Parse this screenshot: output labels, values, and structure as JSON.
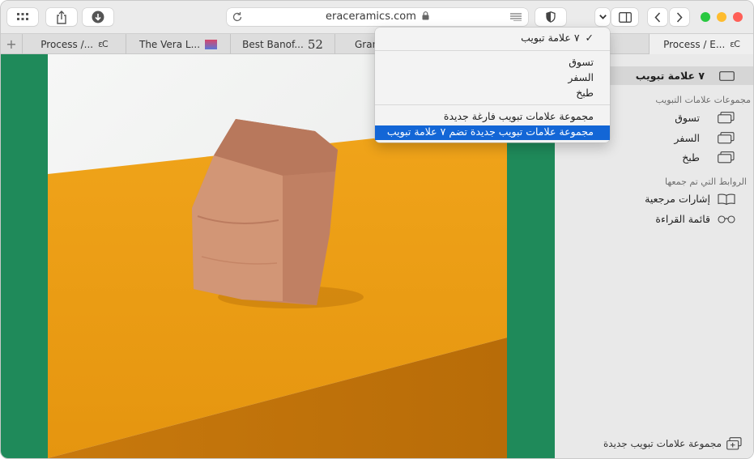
{
  "toolbar": {
    "address": "eraceramics.com",
    "icons": [
      "tab-overview-icon",
      "share-icon",
      "download-icon",
      "reload-icon",
      "lock-icon",
      "reader-icon",
      "privacy-shield-icon",
      "chevron-down-icon",
      "sidebar-icon",
      "back-icon",
      "forward-icon"
    ]
  },
  "tabs": [
    {
      "label": "Process /...",
      "badge": "ɛC"
    },
    {
      "label": "The Vera L...",
      "badge": ""
    },
    {
      "label": "Best Banof...",
      "badge": "52"
    },
    {
      "label": "Gran",
      "badge": ""
    },
    {
      "label": "",
      "badge": ""
    },
    {
      "label": "Process / E...",
      "badge": "ɛC"
    }
  ],
  "menu": {
    "current": "٧ علامة تبويب",
    "checkmark": "✓",
    "groups": [
      "تسوق",
      "السفر",
      "طبخ"
    ],
    "new_empty": "مجموعة علامات تبويب فارغة جديدة",
    "new_with_tabs": "مجموعة علامات تبويب جديدة تضم ٧ علامة تبويب"
  },
  "sidebar": {
    "current": "٧ علامة تبويب",
    "groups_heading": "مجموعات علامات التبويب",
    "groups": [
      "تسوق",
      "السفر",
      "طبخ"
    ],
    "links_heading": "الروابط التي تم جمعها",
    "bookmarks": "إشارات مرجعية",
    "reading_list": "قائمة القراءة",
    "new_group": "مجموعة علامات تبويب جديدة"
  },
  "colors": {
    "accent": "#1366d6",
    "page_green": "#1f8a5a",
    "orange": "#e89a16",
    "clay": "#c98865",
    "close": "#ff5f57",
    "minimize": "#febc2e",
    "zoom": "#28c840"
  }
}
